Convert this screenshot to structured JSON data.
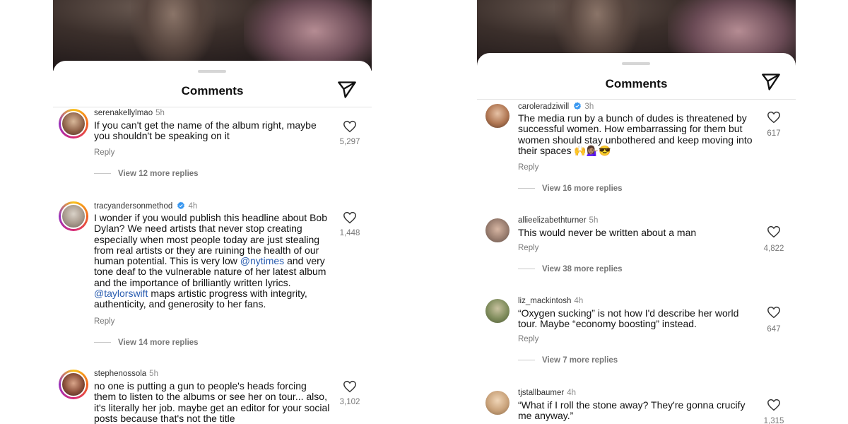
{
  "left": {
    "title": "Comments",
    "comments": [
      {
        "username": "serenakellylmao",
        "time": "5h",
        "text": "If you can't get the name of the album right, maybe you shouldn't be speaking on it",
        "reply": "Reply",
        "likes": "5,297",
        "view_more": "View 12 more replies",
        "verified": false,
        "avatar_color": "#b58a6a"
      },
      {
        "username": "tracyandersonmethod",
        "time": "4h",
        "text_part1": "I wonder if you would publish this headline about Bob Dylan? We need artists that never stop creating especially when most people today are just stealing from real artists or they are ruining the health of our human potential.  This is very low ",
        "mention1": "@nytimes",
        "text_part2": " and very tone deaf to the vulnerable nature of her latest album and the importance of brilliantly written lyrics. ",
        "mention2": "@taylorswift",
        "text_part3": " maps artistic progress with integrity, authenticity, and generosity to her fans.",
        "reply": "Reply",
        "likes": "1,448",
        "view_more": "View 14 more replies",
        "verified": true,
        "avatar_color": "#9a9490"
      },
      {
        "username": "stephenossola",
        "time": "5h",
        "text": "no one is putting a gun to people's heads forcing them to listen to the albums or see her on tour... also, it's literally her job. maybe get an editor for your social posts because that's not the title",
        "likes": "3,102",
        "verified": false,
        "avatar_color": "#5b3a2e"
      }
    ]
  },
  "right": {
    "title": "Comments",
    "comments": [
      {
        "username": "caroleradziwill",
        "time": "3h",
        "text": "The media run by a bunch of dudes is threatened by successful women. How embarrassing for them but women should stay unbothered and keep moving into their spaces 🙌💁🏽‍♀️😎",
        "reply": "Reply",
        "likes": "617",
        "view_more": "View 16 more replies",
        "verified": true,
        "avatar_color": "#a86e50"
      },
      {
        "username": "allieelizabethturner",
        "time": "5h",
        "text": "This would never be written about a man",
        "reply": "Reply",
        "likes": "4,822",
        "view_more": "View 38 more replies",
        "verified": false,
        "avatar_color": "#8d7a70"
      },
      {
        "username": "liz_mackintosh",
        "time": "4h",
        "text": "“Oxygen sucking” is not how I'd describe her world tour. Maybe “economy boosting” instead.",
        "reply": "Reply",
        "likes": "647",
        "view_more": "View 7 more replies",
        "verified": false,
        "avatar_color": "#7d8a5a"
      },
      {
        "username": "tjstallbaumer",
        "time": "4h",
        "text": "“What if I roll the stone away? They're gonna crucify me anyway.”",
        "likes": "1,315",
        "verified": false,
        "avatar_color": "#c9a27a"
      }
    ]
  },
  "colors": {
    "mention": "#2a5db0",
    "verified": "#3897f0",
    "muted_text": "#777777"
  },
  "icons": [
    "send-icon",
    "heart-icon",
    "verified-badge-icon"
  ]
}
